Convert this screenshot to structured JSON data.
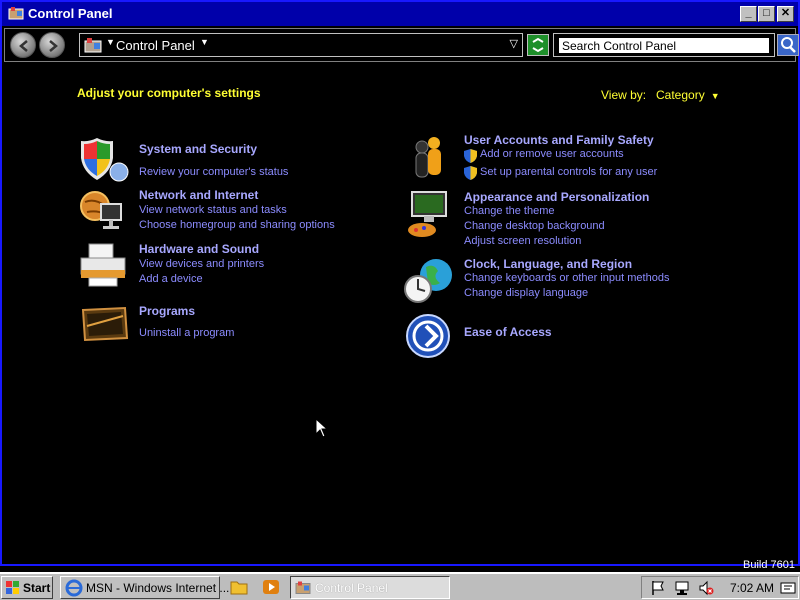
{
  "window": {
    "title": "Control Panel"
  },
  "address": {
    "crumb": "Control Panel"
  },
  "search": {
    "placeholder": "Search Control Panel"
  },
  "content": {
    "heading": "Adjust your computer's settings",
    "view_by_label": "View by:",
    "view_by_value": "Category",
    "categories_left": [
      {
        "title": "System and Security",
        "links": [
          "Review your computer's status"
        ],
        "icon": "shield-icon"
      },
      {
        "title": "Network and Internet",
        "links": [
          "View network status and tasks",
          "Choose homegroup and sharing options"
        ],
        "icon": "network-globe-icon"
      },
      {
        "title": "Hardware and Sound",
        "links": [
          "View devices and printers",
          "Add a device"
        ],
        "icon": "printer-icon"
      },
      {
        "title": "Programs",
        "links": [
          "Uninstall a program"
        ],
        "icon": "programs-icon"
      }
    ],
    "categories_right": [
      {
        "title": "User Accounts and Family Safety",
        "links": [
          "Add or remove user accounts",
          "Set up parental controls for any user"
        ],
        "icon": "users-icon"
      },
      {
        "title": "Appearance and Personalization",
        "links": [
          "Change the theme",
          "Change desktop background",
          "Adjust screen resolution"
        ],
        "icon": "monitor-paint-icon"
      },
      {
        "title": "Clock, Language, and Region",
        "links": [
          "Change keyboards or other input methods",
          "Change display language"
        ],
        "icon": "clock-globe-icon"
      },
      {
        "title": "Ease of Access",
        "links": [],
        "icon": "ease-of-access-icon"
      }
    ]
  },
  "build": "Build 7601",
  "taskbar": {
    "start_label": "Start",
    "tasks": [
      "MSN - Windows Internet ...",
      "Control Panel"
    ],
    "clock": "7:02 AM"
  },
  "colors": {
    "title_bar": "#0000aa",
    "heading": "#ffff33",
    "link": "#8c8cff",
    "background": "#000000"
  }
}
